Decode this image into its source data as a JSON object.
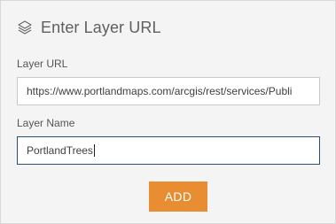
{
  "header": {
    "icon": "layers-icon",
    "title": "Enter Layer URL"
  },
  "form": {
    "url_label": "Layer URL",
    "url_value": "https://www.portlandmaps.com/arcgis/rest/services/Publi",
    "name_label": "Layer Name",
    "name_value": "PortlandTrees",
    "add_label": "ADD"
  },
  "colors": {
    "panel_background": "#f4f4f4",
    "button_accent": "#e98d33",
    "focused_border": "#2b4e78"
  }
}
